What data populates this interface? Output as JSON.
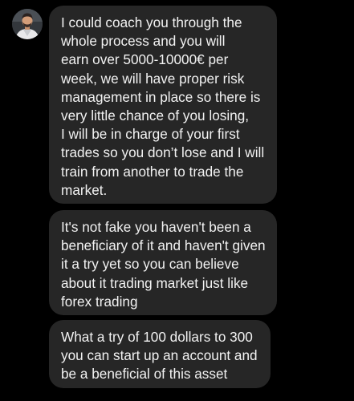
{
  "conversation": {
    "sender_avatar_icon": "user-avatar-photo",
    "messages": [
      {
        "text": "I could coach you through the\nwhole process and you will\nearn over 5000-10000€ per\nweek, we will have proper risk\nmanagement in place so there is\nvery little chance of you losing,\nI will be in charge of your first\ntrades so you don’t lose and I will\ntrain from another to trade the\nmarket."
      },
      {
        "text": "It's not fake you haven't been a\nbeneficiary of it and haven't given\nit a try yet so you can believe\nabout it trading market just like\nforex trading"
      },
      {
        "text": "What a try of 100 dollars to 300\nyou can start up an account and\nbe a beneficial of this asset"
      }
    ]
  },
  "colors": {
    "background": "#000000",
    "bubble": "#262626",
    "text": "#f2f2f2"
  }
}
